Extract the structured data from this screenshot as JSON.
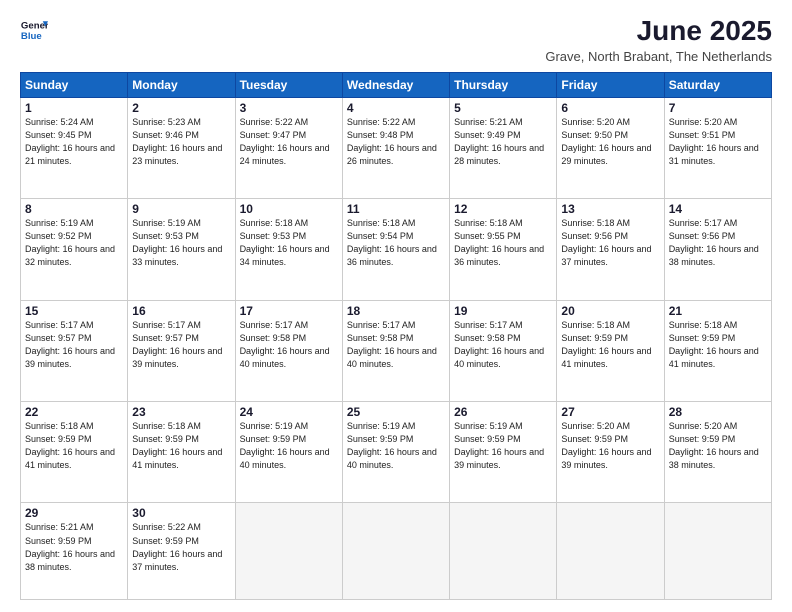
{
  "logo": {
    "line1": "General",
    "line2": "Blue"
  },
  "title": "June 2025",
  "subtitle": "Grave, North Brabant, The Netherlands",
  "days_header": [
    "Sunday",
    "Monday",
    "Tuesday",
    "Wednesday",
    "Thursday",
    "Friday",
    "Saturday"
  ],
  "weeks": [
    [
      {
        "num": "1",
        "rise": "5:24 AM",
        "set": "9:45 PM",
        "daylight": "16 hours and 21 minutes."
      },
      {
        "num": "2",
        "rise": "5:23 AM",
        "set": "9:46 PM",
        "daylight": "16 hours and 23 minutes."
      },
      {
        "num": "3",
        "rise": "5:22 AM",
        "set": "9:47 PM",
        "daylight": "16 hours and 24 minutes."
      },
      {
        "num": "4",
        "rise": "5:22 AM",
        "set": "9:48 PM",
        "daylight": "16 hours and 26 minutes."
      },
      {
        "num": "5",
        "rise": "5:21 AM",
        "set": "9:49 PM",
        "daylight": "16 hours and 28 minutes."
      },
      {
        "num": "6",
        "rise": "5:20 AM",
        "set": "9:50 PM",
        "daylight": "16 hours and 29 minutes."
      },
      {
        "num": "7",
        "rise": "5:20 AM",
        "set": "9:51 PM",
        "daylight": "16 hours and 31 minutes."
      }
    ],
    [
      {
        "num": "8",
        "rise": "5:19 AM",
        "set": "9:52 PM",
        "daylight": "16 hours and 32 minutes."
      },
      {
        "num": "9",
        "rise": "5:19 AM",
        "set": "9:53 PM",
        "daylight": "16 hours and 33 minutes."
      },
      {
        "num": "10",
        "rise": "5:18 AM",
        "set": "9:53 PM",
        "daylight": "16 hours and 34 minutes."
      },
      {
        "num": "11",
        "rise": "5:18 AM",
        "set": "9:54 PM",
        "daylight": "16 hours and 36 minutes."
      },
      {
        "num": "12",
        "rise": "5:18 AM",
        "set": "9:55 PM",
        "daylight": "16 hours and 36 minutes."
      },
      {
        "num": "13",
        "rise": "5:18 AM",
        "set": "9:56 PM",
        "daylight": "16 hours and 37 minutes."
      },
      {
        "num": "14",
        "rise": "5:17 AM",
        "set": "9:56 PM",
        "daylight": "16 hours and 38 minutes."
      }
    ],
    [
      {
        "num": "15",
        "rise": "5:17 AM",
        "set": "9:57 PM",
        "daylight": "16 hours and 39 minutes."
      },
      {
        "num": "16",
        "rise": "5:17 AM",
        "set": "9:57 PM",
        "daylight": "16 hours and 39 minutes."
      },
      {
        "num": "17",
        "rise": "5:17 AM",
        "set": "9:58 PM",
        "daylight": "16 hours and 40 minutes."
      },
      {
        "num": "18",
        "rise": "5:17 AM",
        "set": "9:58 PM",
        "daylight": "16 hours and 40 minutes."
      },
      {
        "num": "19",
        "rise": "5:17 AM",
        "set": "9:58 PM",
        "daylight": "16 hours and 40 minutes."
      },
      {
        "num": "20",
        "rise": "5:18 AM",
        "set": "9:59 PM",
        "daylight": "16 hours and 41 minutes."
      },
      {
        "num": "21",
        "rise": "5:18 AM",
        "set": "9:59 PM",
        "daylight": "16 hours and 41 minutes."
      }
    ],
    [
      {
        "num": "22",
        "rise": "5:18 AM",
        "set": "9:59 PM",
        "daylight": "16 hours and 41 minutes."
      },
      {
        "num": "23",
        "rise": "5:18 AM",
        "set": "9:59 PM",
        "daylight": "16 hours and 41 minutes."
      },
      {
        "num": "24",
        "rise": "5:19 AM",
        "set": "9:59 PM",
        "daylight": "16 hours and 40 minutes."
      },
      {
        "num": "25",
        "rise": "5:19 AM",
        "set": "9:59 PM",
        "daylight": "16 hours and 40 minutes."
      },
      {
        "num": "26",
        "rise": "5:19 AM",
        "set": "9:59 PM",
        "daylight": "16 hours and 39 minutes."
      },
      {
        "num": "27",
        "rise": "5:20 AM",
        "set": "9:59 PM",
        "daylight": "16 hours and 39 minutes."
      },
      {
        "num": "28",
        "rise": "5:20 AM",
        "set": "9:59 PM",
        "daylight": "16 hours and 38 minutes."
      }
    ],
    [
      {
        "num": "29",
        "rise": "5:21 AM",
        "set": "9:59 PM",
        "daylight": "16 hours and 38 minutes."
      },
      {
        "num": "30",
        "rise": "5:22 AM",
        "set": "9:59 PM",
        "daylight": "16 hours and 37 minutes."
      },
      null,
      null,
      null,
      null,
      null
    ]
  ]
}
